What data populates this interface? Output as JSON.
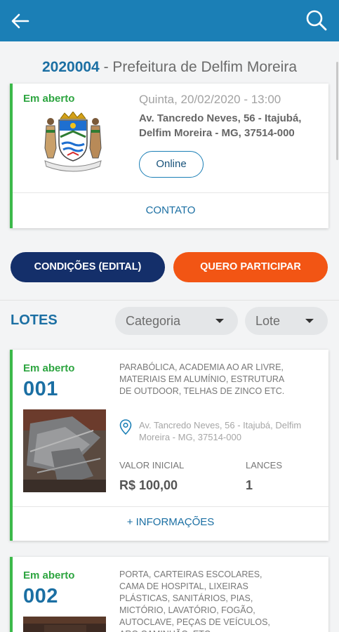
{
  "colors": {
    "appbar": "#1b7fb6",
    "accent": "#1b6fa3",
    "status_open": "#2da540",
    "primary_dark": "#142f6a",
    "cta_orange": "#f25514"
  },
  "appbar": {
    "back_icon": "arrow-left-icon",
    "search_icon": "search-icon"
  },
  "auction": {
    "code": "2020004",
    "separator": " - ",
    "name": "Prefeitura de Delfim Moreira",
    "status": "Em aberto",
    "date": "Quinta, 20/02/2020 - 13:00",
    "address": "Av. Tancredo Neves, 56 - Itajubá, Delfim Moreira - MG, 37514-000",
    "mode": "Online",
    "contact_label": "CONTATO"
  },
  "actions": {
    "conditions_label": "CONDIÇÕES (EDITAL)",
    "participate_label": "QUERO PARTICIPAR"
  },
  "lots_section": {
    "title": "LOTES",
    "filter_category": "Categoria",
    "filter_lot": "Lote"
  },
  "lots": [
    {
      "status": "Em aberto",
      "number": "001",
      "description": "PARABÓLICA, ACADEMIA AO AR LIVRE, MATERIAIS EM ALUMÍNIO, ESTRUTURA DE OUTDOOR, TELHAS DE ZINCO ETC.",
      "location": "Av. Tancredo Neves, 56 - Itajubá, Delfim Moreira - MG, 37514-000",
      "initial_value_label": "VALOR INICIAL",
      "initial_value": "R$ 100,00",
      "bids_label": "LANCES",
      "bids": "1",
      "more_info_label": "+ INFORMAÇÕES"
    },
    {
      "status": "Em aberto",
      "number": "002",
      "description": "PORTA, CARTEIRAS ESCOLARES, CAMA DE HOSPITAL, LIXEIRAS PLÁSTICAS, SANITÁRIOS, PIAS, MICTÓRIO, LAVATÓRIO, FOGÃO, AUTOCLAVE, PEÇAS DE VEÍCULOS, ARO CAMINHÃO, ETC."
    }
  ]
}
